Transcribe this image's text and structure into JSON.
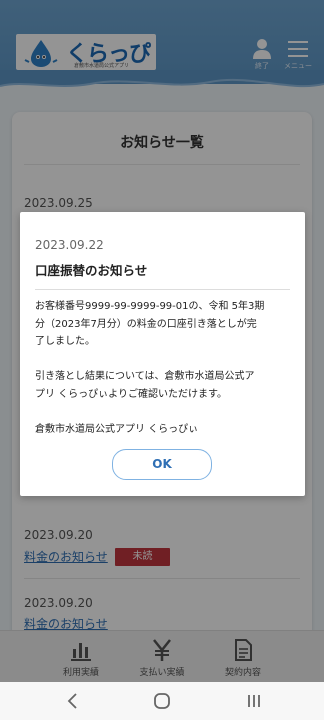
{
  "header": {
    "logo_title": "くらっぴぃ",
    "logo_subtitle": "倉敷市水道局公式アプリ",
    "user_label": "終了",
    "menu_label": "メニュー"
  },
  "main": {
    "title": "お知らせ一覧",
    "items": [
      {
        "date": "2023.09.25",
        "title": "",
        "badge": ""
      },
      {
        "date": "2023.09.20",
        "title": "料金のお知らせ",
        "badge": "未読"
      },
      {
        "date": "2023.09.20",
        "title": "料金のお知らせ",
        "badge": ""
      }
    ]
  },
  "modal": {
    "date": "2023.09.22",
    "title": "口座振替のお知らせ",
    "lines": [
      "お客様番号9999-99-9999-99-01の、令和 5年3期",
      "分（2023年7月分）の料金の口座引き落としが完",
      "了しました。",
      "",
      "引き落とし結果については、倉敷市水道局公式ア",
      "プリ くらっぴぃよりご確認いただけます。",
      "",
      "倉敷市水道局公式アプリ くらっぴぃ"
    ],
    "ok_label": "OK"
  },
  "bottom_nav": {
    "usage": "利用実績",
    "payment": "支払い実績",
    "contract": "契約内容"
  },
  "colors": {
    "header": "#5d97c7",
    "link": "#2f6fb4",
    "badge": "#c1363f"
  }
}
